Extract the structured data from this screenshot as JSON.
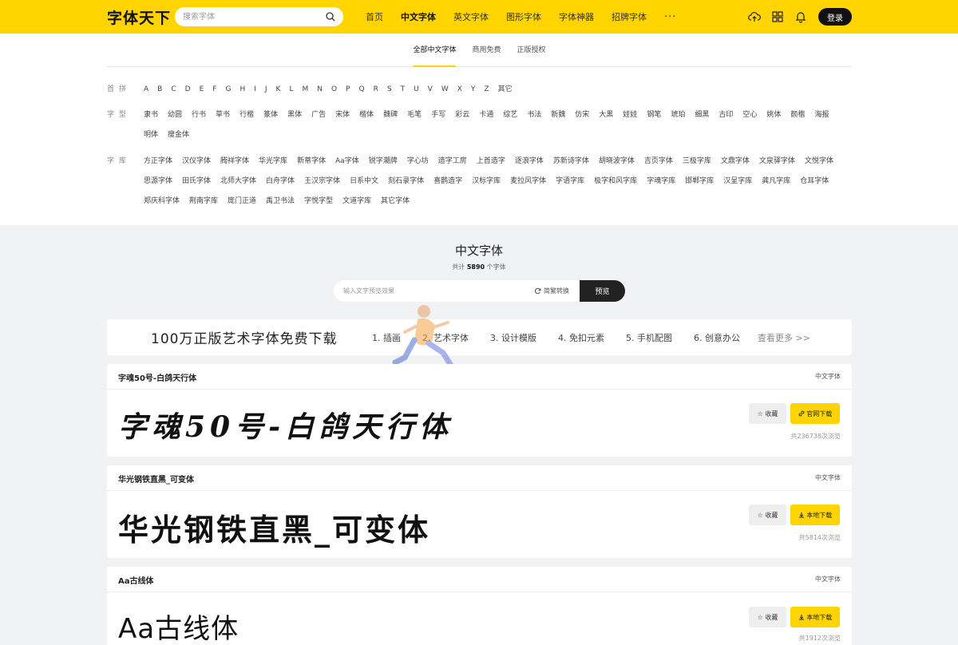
{
  "header": {
    "logo": "字体天下",
    "search_placeholder": "搜索字体",
    "nav": [
      "首页",
      "中文字体",
      "英文字体",
      "图形字体",
      "字体神器",
      "招牌字体",
      "···"
    ],
    "active_nav": "中文字体",
    "icons": [
      "upload-cloud-icon",
      "grid-icon",
      "bell-icon"
    ],
    "login": "登录",
    "accent_color": "#ffd400"
  },
  "tabs": [
    "全部中文字体",
    "商用免费",
    "正版授权"
  ],
  "filters": {
    "letters_label": "首拼",
    "letters": [
      "A",
      "B",
      "C",
      "D",
      "E",
      "F",
      "G",
      "H",
      "I",
      "J",
      "K",
      "L",
      "M",
      "N",
      "O",
      "P",
      "Q",
      "R",
      "S",
      "T",
      "U",
      "V",
      "W",
      "X",
      "Y",
      "Z",
      "其它"
    ],
    "types_label": "字型",
    "types": [
      "隶书",
      "幼圆",
      "行书",
      "草书",
      "行楷",
      "篆体",
      "黑体",
      "广告",
      "宋体",
      "楷体",
      "魏碑",
      "毛笔",
      "手写",
      "彩云",
      "卡通",
      "综艺",
      "书法",
      "新魏",
      "仿宋",
      "大黑",
      "娃娃",
      "钢笔",
      "琥珀",
      "细黑",
      "古印",
      "空心",
      "姚体",
      "颜楷",
      "海报",
      "明体",
      "瘦金体"
    ],
    "libs_label": "字库",
    "libs": [
      "方正字体",
      "汉仪字体",
      "腾祥字体",
      "华光字库",
      "新蒂字体",
      "Aa字体",
      "锐字潮牌",
      "字心坊",
      "造字工房",
      "上首造字",
      "逐浪字体",
      "苏新诗字体",
      "胡晓波字体",
      "吉页字体",
      "三极字库",
      "文鼎字体",
      "文泉驿字体",
      "文悦字体",
      "思源字体",
      "田氏字体",
      "北师大字体",
      "白舟字体",
      "王汉宗字体",
      "日系中文",
      "刻石录字体",
      "喜鹊造字",
      "汉标字库",
      "麦拉风字体",
      "字语字库",
      "极字和风字库",
      "字魂字库",
      "邯郸字库",
      "汉呈字库",
      "龚凡字库",
      "仓耳字体",
      "郑庆科字体",
      "荆南字库",
      "庞门正道",
      "禹卫书法",
      "字悦字型",
      "文道字库",
      "其它字体"
    ]
  },
  "mid": {
    "title": "中文字体",
    "count_prefix": "共计",
    "count": "5890",
    "count_suffix": "个字体",
    "preview_placeholder": "输入文字预览效果",
    "convert": "简繁转换",
    "preview_button": "预览"
  },
  "banner": {
    "title": "100万正版艺术字体免费下载",
    "links": [
      "1. 插画",
      "2. 艺术字体",
      "3. 设计模版",
      "4. 免扣元素",
      "5. 手机配图",
      "6. 创意办公"
    ],
    "more": "查看更多 >>"
  },
  "fonts": [
    {
      "name": "字魂50号-白鸽天行体",
      "category": "中文字体",
      "preview": "字魂50号-白鸽天行体",
      "fav": "☆ 收藏",
      "download": "官网下载",
      "download_icon": "link-icon",
      "views": "共236738次浏览"
    },
    {
      "name": "华光钢铁直黑_可变体",
      "category": "中文字体",
      "preview": "华光钢铁直黑_可变体",
      "fav": "☆ 收藏",
      "download": "本地下载",
      "download_icon": "download-icon",
      "views": "共5814次浏览"
    },
    {
      "name": "Aa古线体",
      "category": "中文字体",
      "preview": "Aa古线体",
      "fav": "☆ 收藏",
      "download": "本地下载",
      "download_icon": "download-icon",
      "views": "共1912次浏览"
    }
  ]
}
